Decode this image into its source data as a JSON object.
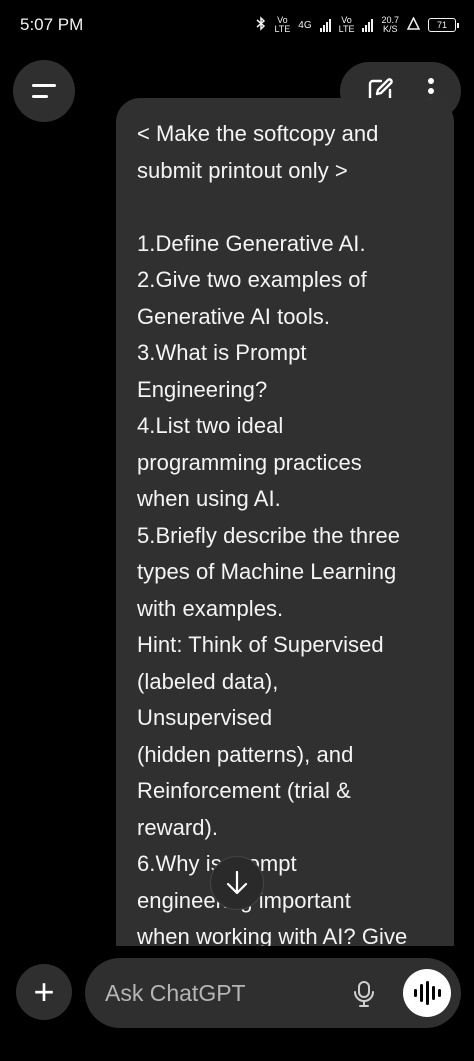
{
  "status_bar": {
    "time": "5:07 PM",
    "sim1_top": "Vo",
    "sim1_bottom": "LTE",
    "network": "4G",
    "sim2_top": "Vo",
    "sim2_bottom": "LTE",
    "speed_value": "20.7",
    "speed_unit": "K/S",
    "battery": "71"
  },
  "header": {
    "menu_icon": "menu-icon",
    "new_chat_icon": "edit-icon",
    "more_icon": "more-vertical-icon"
  },
  "message": {
    "text": "< Make the softcopy and\nsubmit printout only >\n\n1.Define Generative AI.\n2.Give two examples of\nGenerative AI tools.\n3.What is Prompt\nEngineering?\n4.List two ideal\nprogramming practices\nwhen using AI.\n5.Briefly describe the three\ntypes of Machine Learning\nwith examples.\nHint: Think of Supervised\n(labeled data),\nUnsupervised\n(hidden patterns), and\nReinforcement (trial &\nreward).\n6.Why is prompt\nengineering important\nwhen working with AI? Give"
  },
  "composer": {
    "placeholder": "Ask ChatGPT",
    "value": "",
    "plus_label": "+"
  },
  "colors": {
    "background": "#000000",
    "bubble": "#303030",
    "control": "#2f2f2f",
    "text": "#f4f4f4"
  }
}
